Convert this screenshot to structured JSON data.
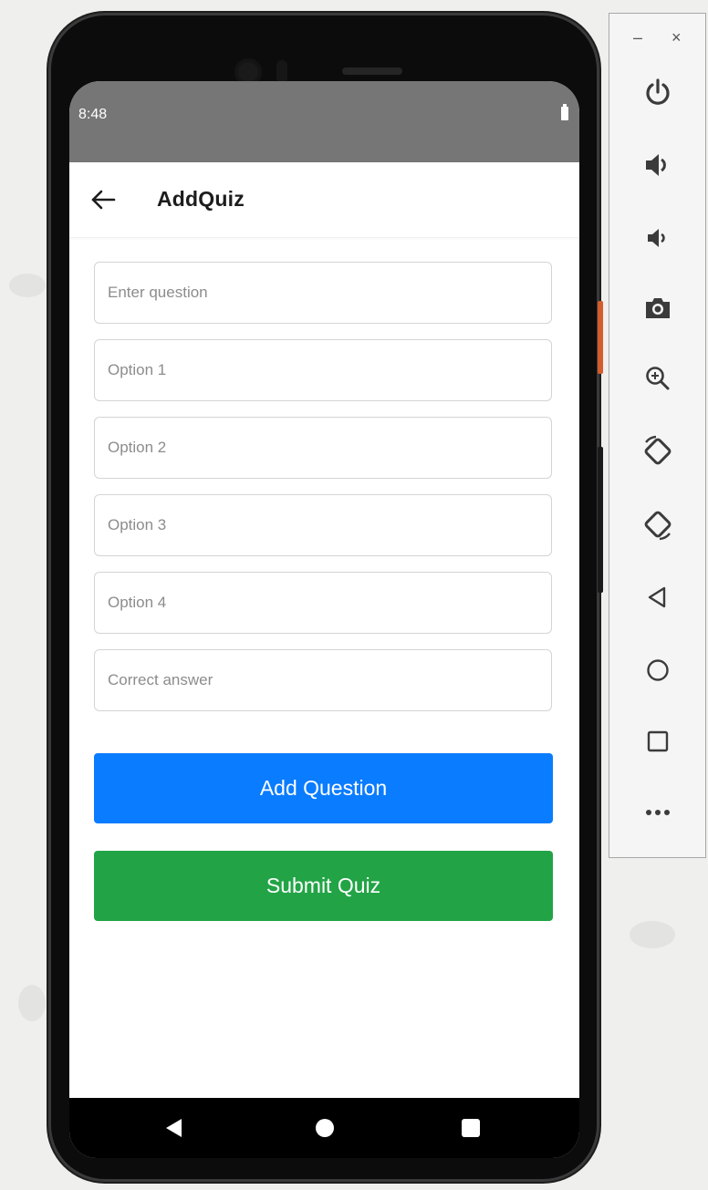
{
  "status_bar": {
    "time": "8:48"
  },
  "app_bar": {
    "title": "AddQuiz"
  },
  "form": {
    "question_placeholder": "Enter question",
    "option1_placeholder": "Option 1",
    "option2_placeholder": "Option 2",
    "option3_placeholder": "Option 3",
    "option4_placeholder": "Option 4",
    "correct_answer_placeholder": "Correct answer"
  },
  "buttons": {
    "add_question": "Add Question",
    "submit_quiz": "Submit Quiz"
  },
  "colors": {
    "add_question_bg": "#0a7cff",
    "submit_quiz_bg": "#22a446",
    "status_bar_bg": "#767676",
    "toolbar_icon": "#3b3b3b"
  },
  "emulator_toolbar": {
    "minimize": "–",
    "close": "×",
    "icons": [
      "power-icon",
      "volume-up-icon",
      "volume-down-icon",
      "camera-icon",
      "zoom-icon",
      "rotate-left-icon",
      "rotate-right-icon",
      "back-icon",
      "home-icon",
      "overview-icon",
      "more-icon"
    ]
  },
  "nav_bar": {
    "icons": [
      "nav-back-icon",
      "nav-home-icon",
      "nav-recents-icon"
    ]
  }
}
